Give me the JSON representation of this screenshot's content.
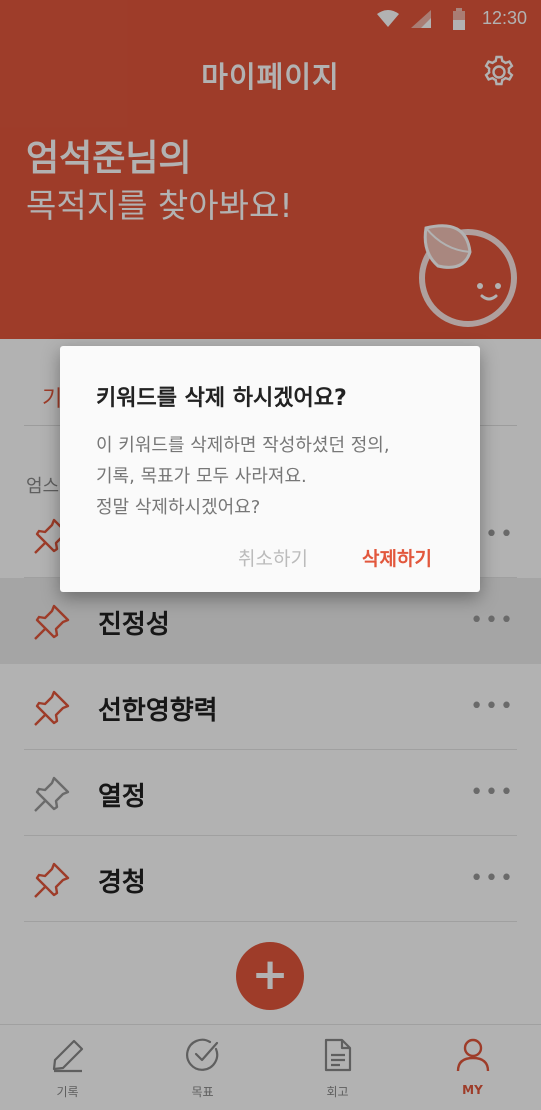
{
  "status_bar": {
    "time": "12:30"
  },
  "header": {
    "title": "마이페이지",
    "greeting_name": "엄석준님의",
    "greeting_line2": "목적지를 찾아봐요!"
  },
  "tabs": {
    "active_label_partial": "기"
  },
  "section": {
    "label_partial": "엄스"
  },
  "keywords": [
    {
      "label": "",
      "pinned": true,
      "more": "•••"
    },
    {
      "label": "진정성",
      "pinned": true,
      "more": "•••"
    },
    {
      "label": "선한영향력",
      "pinned": true,
      "more": "•••"
    },
    {
      "label": "열정",
      "pinned": false,
      "more": "•••"
    },
    {
      "label": "경청",
      "pinned": true,
      "more": "•••"
    }
  ],
  "fab": {
    "symbol": "+"
  },
  "bottom_nav": [
    {
      "label": "기록",
      "icon": "pencil-icon",
      "active": false
    },
    {
      "label": "목표",
      "icon": "check-circle-icon",
      "active": false
    },
    {
      "label": "회고",
      "icon": "document-icon",
      "active": false
    },
    {
      "label": "MY",
      "icon": "person-icon",
      "active": true
    }
  ],
  "dialog": {
    "title": "키워드를 삭제 하시겠어요?",
    "body_lines": [
      "이 키워드를 삭제하면 작성하셨던 정의,",
      "기록, 목표가 모두 사라져요.",
      "정말 삭제하시겠어요?"
    ],
    "cancel_label": "취소하기",
    "confirm_label": "삭제하기"
  },
  "colors": {
    "accent": "#e2573c",
    "pin_active": "#e2573c",
    "pin_inactive": "#9a9a9a"
  }
}
